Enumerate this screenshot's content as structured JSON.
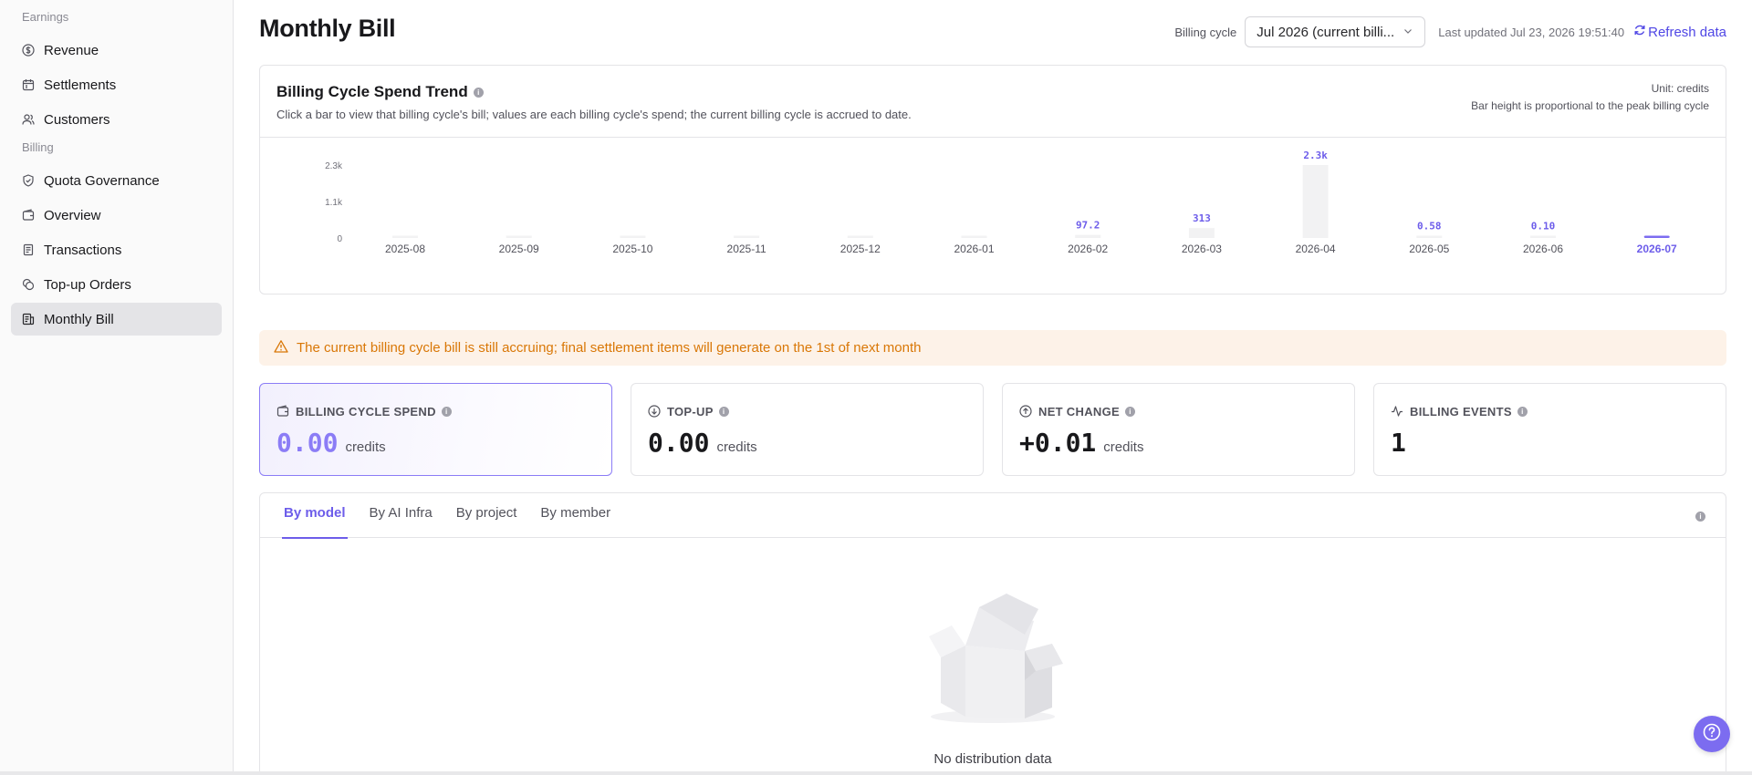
{
  "sidebar": {
    "group_earnings": "Earnings",
    "group_billing": "Billing",
    "items": [
      {
        "label": "Revenue",
        "icon": "dollar-circle-icon"
      },
      {
        "label": "Settlements",
        "icon": "calendar-icon"
      },
      {
        "label": "Customers",
        "icon": "users-icon"
      },
      {
        "label": "Quota Governance",
        "icon": "shield-check-icon"
      },
      {
        "label": "Overview",
        "icon": "wallet-icon"
      },
      {
        "label": "Transactions",
        "icon": "receipt-icon"
      },
      {
        "label": "Top-up Orders",
        "icon": "coins-icon"
      },
      {
        "label": "Monthly Bill",
        "icon": "bill-icon",
        "active": true
      }
    ]
  },
  "header": {
    "title": "Monthly Bill",
    "billing_cycle_label": "Billing cycle",
    "billing_cycle_value": "Jul 2026 (current billi...",
    "last_updated": "Last updated Jul 23, 2026 19:51:40",
    "refresh_label": "Refresh data"
  },
  "trend": {
    "title": "Billing Cycle Spend Trend",
    "subtitle": "Click a bar to view that billing cycle's bill; values are each billing cycle's spend; the current billing cycle is accrued to date.",
    "unit": "Unit: credits",
    "note": "Bar height is proportional to the peak billing cycle"
  },
  "chart_data": {
    "type": "bar",
    "categories": [
      "2025-08",
      "2025-09",
      "2025-10",
      "2025-11",
      "2025-12",
      "2026-01",
      "2026-02",
      "2026-03",
      "2026-04",
      "2026-05",
      "2026-06",
      "2026-07"
    ],
    "values": [
      0,
      0,
      0,
      0,
      0,
      0,
      97.2,
      313,
      2300,
      0.58,
      0.1,
      0
    ],
    "data_labels": [
      "",
      "",
      "",
      "",
      "",
      "",
      "97.2",
      "313",
      "2.3k",
      "0.58",
      "0.10",
      ""
    ],
    "y_ticks": [
      "2.3k",
      "1.1k",
      "0"
    ],
    "ylim": [
      0,
      2300
    ],
    "selected": "2026-07",
    "colors": {
      "bar": "#f2f2f3",
      "selected": "#7c6cf0",
      "label": "#6d5dea",
      "axis_text": "#52525b"
    }
  },
  "notice": {
    "text": "The current billing cycle bill is still accruing; final settlement items will generate on the 1st of next month"
  },
  "stats": [
    {
      "label": "BILLING CYCLE SPEND",
      "value": "0.00",
      "unit": "credits",
      "icon": "wallet-icon"
    },
    {
      "label": "TOP-UP",
      "value": "0.00",
      "unit": "credits",
      "icon": "arrow-down-circle-icon"
    },
    {
      "label": "NET CHANGE",
      "value": "+0.01",
      "unit": "credits",
      "icon": "arrow-up-circle-icon"
    },
    {
      "label": "BILLING EVENTS",
      "value": "1",
      "unit": "",
      "icon": "activity-icon"
    }
  ],
  "distribution": {
    "tabs": [
      "By model",
      "By AI Infra",
      "By project",
      "By member"
    ],
    "active_tab": "By model",
    "empty_text": "No distribution data"
  },
  "colors": {
    "accent": "#7c6cf0",
    "warning_bg": "#fdf2e8",
    "warning_text": "#d97706"
  }
}
